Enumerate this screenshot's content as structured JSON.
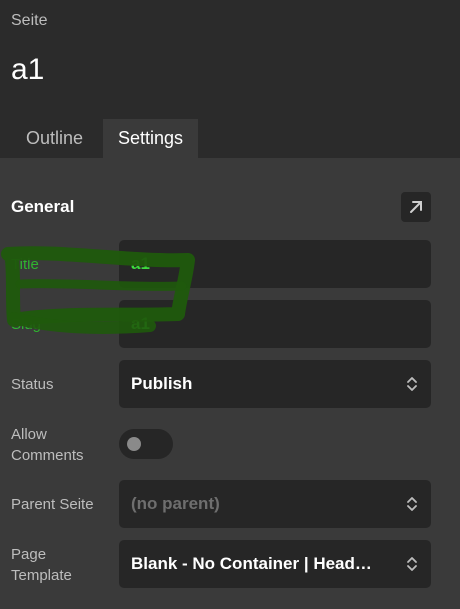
{
  "header": {
    "type_label": "Seite",
    "title": "a1"
  },
  "tabs": [
    {
      "label": "Outline",
      "active": false
    },
    {
      "label": "Settings",
      "active": true
    }
  ],
  "general": {
    "section_title": "General",
    "expand_icon": "arrow-up-right-icon",
    "fields": {
      "title": {
        "label": "Title",
        "value": "a1"
      },
      "slug": {
        "label": "Slug",
        "value": "a1"
      },
      "status": {
        "label": "Status",
        "value": "Publish"
      },
      "allow_comments": {
        "label": "Allow Comments",
        "enabled": false
      },
      "parent": {
        "label": "Parent Seite",
        "value": "(no parent)"
      },
      "page_template": {
        "label": "Page Template",
        "value": "Blank - No Container | Head…"
      }
    }
  },
  "colors": {
    "header_bg": "#2b2b2b",
    "panel_bg": "#3a3a3a",
    "field_bg": "#262626",
    "highlight_green": "#2fb52f",
    "scribble_green": "#1f5a0c"
  }
}
